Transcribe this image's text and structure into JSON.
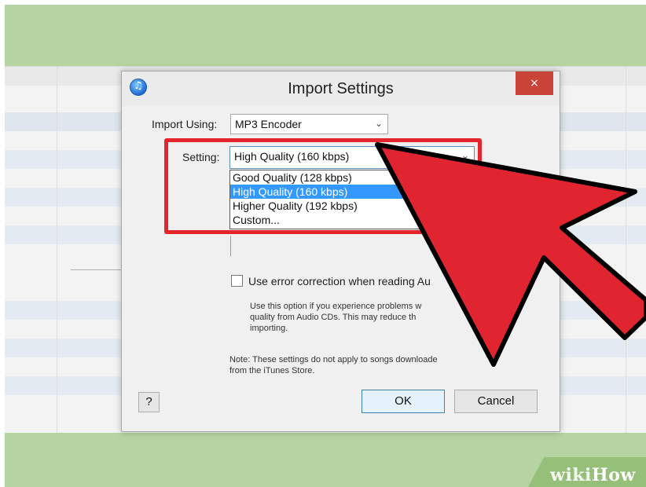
{
  "dialog": {
    "title": "Import Settings",
    "close_glyph": "×",
    "import_using_label": "Import Using:",
    "import_using_value": "MP3 Encoder",
    "setting_label": "Setting:",
    "setting_value": "High Quality (160 kbps)",
    "setting_options": [
      {
        "label": "Good Quality (128 kbps)",
        "selected": false
      },
      {
        "label": "High Quality (160 kbps)",
        "selected": true
      },
      {
        "label": "Higher Quality (192 kbps)",
        "selected": false
      },
      {
        "label": "Custom...",
        "selected": false
      }
    ],
    "error_correction_label": "Use error correction when reading Au",
    "error_correction_checked": false,
    "help_lines": [
      "Use this option if you experience problems w",
      "quality from Audio CDs.  This may reduce th",
      "importing."
    ],
    "note_lines": [
      "Note: These settings do not apply to songs downloade",
      "from the iTunes Store."
    ],
    "help_button": "?",
    "ok_button": "OK",
    "cancel_button": "Cancel"
  },
  "annotation": {
    "arrow_color": "#e02531",
    "highlight_color": "#e4262c"
  },
  "watermark": {
    "wiki": "wiki",
    "how": "How"
  },
  "colors": {
    "frame_green": "#b6d3a2",
    "selection_blue": "#3399ff",
    "close_red": "#c84438"
  }
}
